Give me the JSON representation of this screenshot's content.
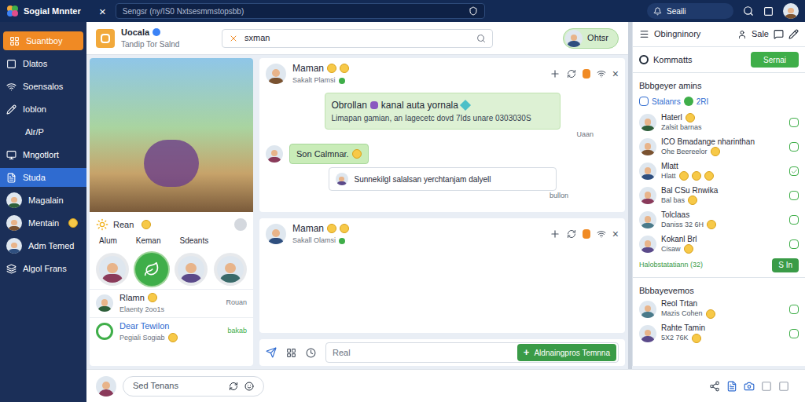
{
  "app": {
    "title": "Sogial Mnnter",
    "close": "×",
    "address": "Sengsr (ny/IS0 Nxtsesmmstopsbb)",
    "search": "Seaili"
  },
  "sidebar": {
    "items": [
      {
        "label": "Suantboy",
        "kind": "icon",
        "selected": true,
        "focused": false,
        "emoji": 0
      },
      {
        "label": "Dlatos",
        "kind": "icon",
        "selected": false,
        "focused": false,
        "emoji": 0
      },
      {
        "label": "Soensalos",
        "kind": "icon",
        "selected": false,
        "focused": false,
        "emoji": 0
      },
      {
        "label": "Ioblon",
        "kind": "icon",
        "selected": false,
        "focused": false,
        "emoji": 0
      },
      {
        "label": "Alr/P",
        "kind": "text",
        "selected": false,
        "focused": false,
        "emoji": 0
      },
      {
        "label": "Mngotlort",
        "kind": "icon",
        "selected": false,
        "focused": false,
        "emoji": 0
      },
      {
        "label": "Studa",
        "kind": "icon",
        "selected": false,
        "focused": true,
        "emoji": 0
      },
      {
        "label": "Magalain",
        "kind": "avatar",
        "selected": false,
        "focused": false,
        "emoji": 0
      },
      {
        "label": "Mentain",
        "kind": "avatar",
        "selected": false,
        "focused": false,
        "emoji": 1
      },
      {
        "label": "Adm Temed",
        "kind": "avatar",
        "selected": false,
        "focused": false,
        "emoji": 0
      },
      {
        "label": "Algol Frans",
        "kind": "icon",
        "selected": false,
        "focused": false,
        "emoji": 0
      }
    ]
  },
  "header": {
    "title": "Uocala",
    "verified": true,
    "subtitle": "Tandip Tor Salnd",
    "search": "sxman",
    "button": "Ohtsr"
  },
  "stories": {
    "title": "Rean",
    "tabs": [
      "Alum",
      "Keman",
      "Sdeants"
    ],
    "avatars": [
      {
        "selected": false
      },
      {
        "selected": true
      },
      {
        "selected": false
      },
      {
        "selected": false
      },
      {
        "selected": false
      }
    ]
  },
  "feed": [
    {
      "name": "Rlamn",
      "name_emoji": 1,
      "meta": "Elaenty 2oo1s",
      "meta_emoji": 0,
      "action": "Rouan",
      "kind": "avatar"
    },
    {
      "name": "Dear Tewilon",
      "name_emoji": 0,
      "meta": "Pegiali Sogiab",
      "meta_emoji": 1,
      "action": "bakab",
      "kind": "ring"
    }
  ],
  "chats": [
    {
      "name": "Maman",
      "name_emoji": 2,
      "subtitle": "Sakalt Plamsi",
      "close": "×",
      "messages": [
        {
          "kind": "card",
          "title": "Obrollan",
          "title_tail": "kanal auta yornala",
          "body": "Limapan gamian, an Iagecetc dovd 7Ids unare 0303030S",
          "time": "Uaan"
        },
        {
          "kind": "bubble",
          "text": "Son Calmnar.",
          "emoji": 1
        },
        {
          "kind": "quote",
          "text": "Sunnekilgl salalsan yerchtanjam dalyell",
          "time": "bullon"
        }
      ]
    },
    {
      "name": "Maman",
      "name_emoji": 2,
      "subtitle": "Sakall Olamsi",
      "close": "×",
      "messages": []
    }
  ],
  "composer": {
    "placeholder": "Real",
    "button_icon": "+",
    "button": "Aldnaingpros Temnna"
  },
  "bottom": {
    "placeholder": "Sed Tenans"
  },
  "panel": {
    "title": "Obingninory",
    "tab": "Sale",
    "radio": {
      "label": "Kommatts",
      "selected": false
    },
    "button": "Sernai",
    "section1": "Bbbgeyer amins",
    "filter": {
      "label": "Stalanrs",
      "count": "2RI",
      "checked": false
    },
    "contacts": [
      {
        "name": "Haterl",
        "name_emoji": 1,
        "sub": "Zalsit barnas",
        "sub_emoji": 0,
        "checked": false
      },
      {
        "name": "ICO Bmadange nharinthan",
        "name_emoji": 0,
        "sub": "Ohe Beereelor",
        "sub_emoji": 1,
        "checked": false
      },
      {
        "name": "Mlatt",
        "name_emoji": 0,
        "sub": "Hlatt",
        "sub_emoji": 3,
        "checked": true
      },
      {
        "name": "Bal CSu Rnwika",
        "name_emoji": 0,
        "sub": "Bal bas",
        "sub_emoji": 1,
        "checked": false
      },
      {
        "name": "Tolclaas",
        "name_emoji": 0,
        "sub": "Daniss 32 6H",
        "sub_emoji": 1,
        "checked": false
      },
      {
        "name": "Kokanl Brl",
        "name_emoji": 0,
        "sub": "Cisaw",
        "sub_emoji": 1,
        "checked": false
      }
    ],
    "footer": {
      "text": "Halobstatatiann (32)",
      "button": "S In"
    },
    "section2": "Bbbayevemos",
    "contacts2": [
      {
        "name": "Reol Trtan",
        "sub": "Mazis Cohen",
        "sub_emoji": 1
      },
      {
        "name": "Rahte Tamin",
        "sub": "5X2 76K",
        "sub_emoji": 1
      }
    ]
  }
}
